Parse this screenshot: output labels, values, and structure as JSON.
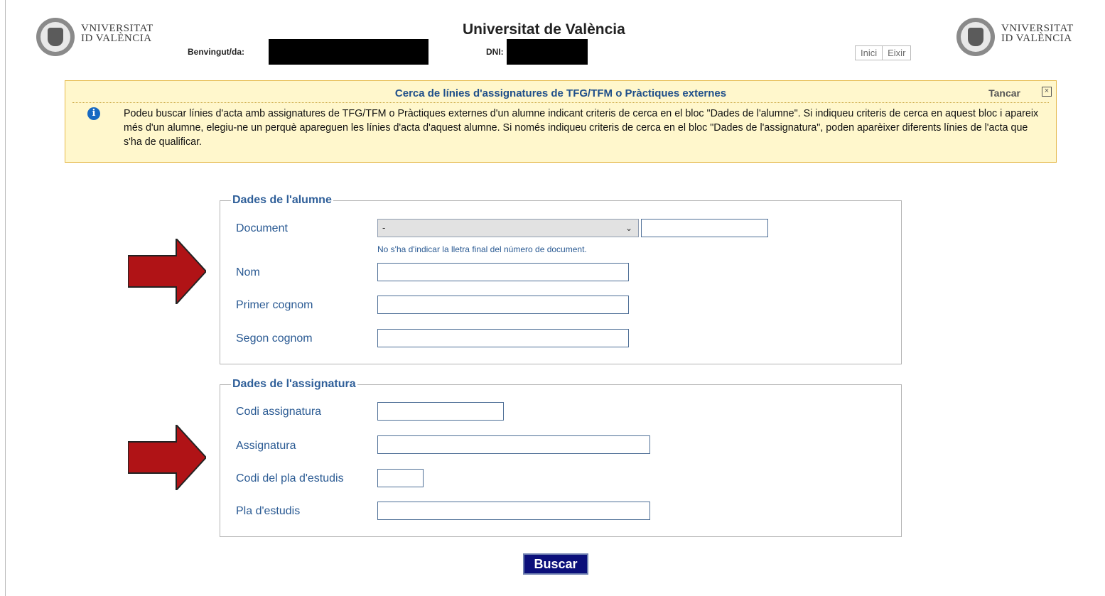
{
  "header": {
    "title": "Universitat de València",
    "logo_text_line1": "VNIVERSITAT",
    "logo_text_line2": "ID VALÈNCIA",
    "welcome_label": "Benvingut/da:",
    "dni_label": "DNI:",
    "links": [
      "Inici",
      "Eixir"
    ]
  },
  "notice": {
    "title": "Cerca de línies d'assignatures de TFG/TFM o Pràctiques externes",
    "close_label": "Tancar",
    "close_icon": "close-box-icon",
    "text": "Podeu buscar línies d'acta amb assignatures de TFG/TFM o Pràctiques externes d'un alumne indicant criteris de cerca en el bloc \"Dades de l'alumne\". Si indiqueu criteris de cerca en aquest bloc i apareix més d'un alumne, elegiu-ne un perquè apareguen les línies d'acta d'aquest alumne. Si només indiqueu criteris de cerca en el bloc \"Dades de l'assignatura\", poden aparèixer diferents línies de l'acta que s'ha de qualificar."
  },
  "alumne": {
    "legend": "Dades de l'alumne",
    "document_label": "Document",
    "document_select_value": "-",
    "document_hint": "No s'ha d'indicar la lletra final del número de document.",
    "nom_label": "Nom",
    "primer_cognom_label": "Primer cognom",
    "segon_cognom_label": "Segon cognom"
  },
  "assignatura": {
    "legend": "Dades de l'assignatura",
    "codi_label": "Codi assignatura",
    "assignatura_label": "Assignatura",
    "codi_pla_label": "Codi del pla d'estudis",
    "pla_label": "Pla d'estudis"
  },
  "search_button": "Buscar",
  "colors": {
    "accent_blue": "#2a5a93",
    "notice_bg": "#fff7cc",
    "arrow_red": "#b01316",
    "button_bg": "#0b0f7a"
  }
}
